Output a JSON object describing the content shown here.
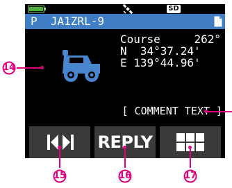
{
  "status_bar": {
    "battery_icon": "battery-icon",
    "gps_icon": "satellite-icon",
    "sd_label": "SD"
  },
  "title_bar": {
    "mode_letter": "P",
    "callsign": "JA1ZRL-9",
    "text": "P  JA1ZRL-9",
    "doc_icon": "document-icon",
    "color": "#3f7ec4"
  },
  "station": {
    "icon": "jeep-icon",
    "course_label": "Course",
    "course_value": "262°",
    "latitude": "N  34°37.24'",
    "longitude": "E 139°44.96'",
    "comment": "[ COMMENT TEXT ]"
  },
  "softkeys": {
    "skip_icon": "skip-prev-next-icon",
    "reply_label": "REPLY",
    "grid_icon": "grid-menu-icon",
    "color": "#3a3a3a"
  },
  "callouts": {
    "c14": "14",
    "c15": "15",
    "c16": "16",
    "c17": "17",
    "color": "#e3007f"
  }
}
